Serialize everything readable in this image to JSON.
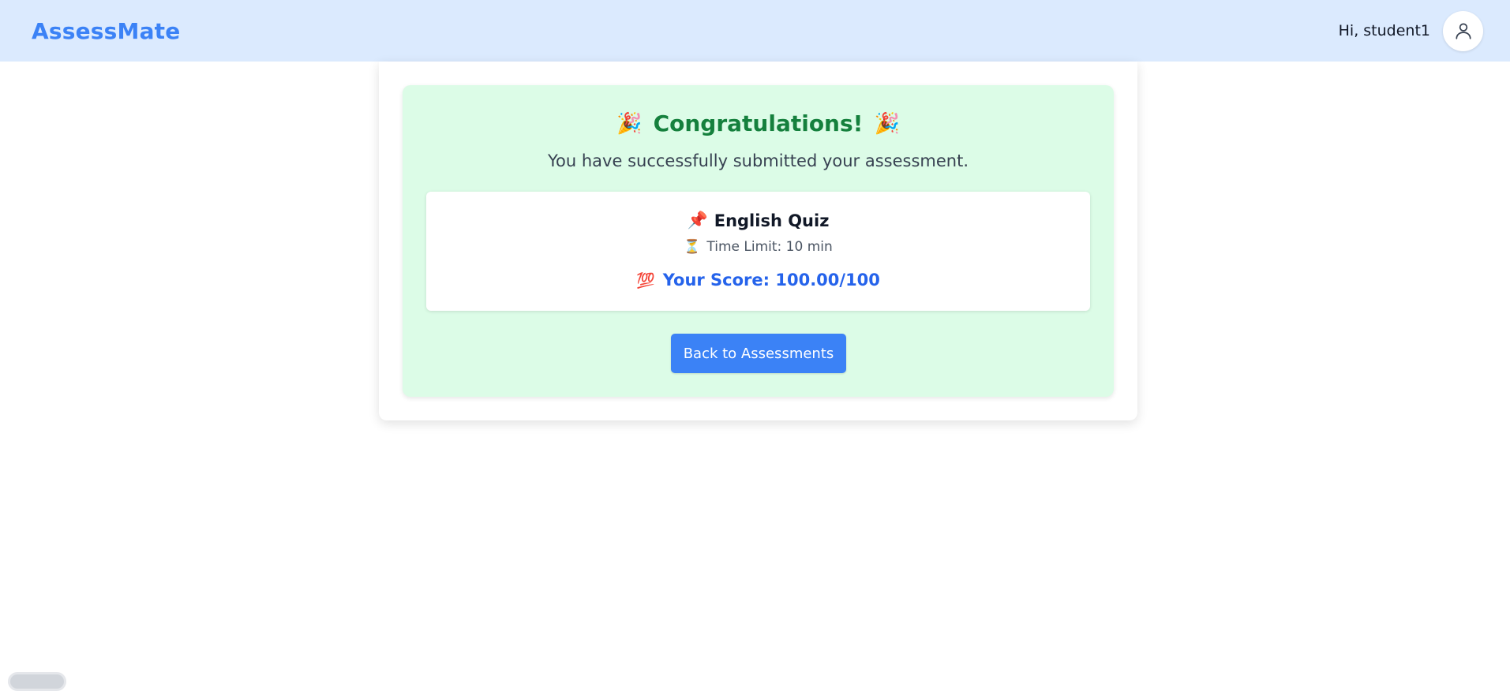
{
  "header": {
    "brand": "AssessMate",
    "greeting": "Hi, student1",
    "avatar_icon": "user-icon"
  },
  "result": {
    "title": "Congratulations!",
    "title_emoji_left": "🎉",
    "title_emoji_right": "🎉",
    "message": "You have successfully submitted your assessment.",
    "quiz": {
      "pin_emoji": "📌",
      "name": "English Quiz",
      "hourglass_emoji": "⏳",
      "time_limit": "Time Limit: 10 min",
      "score_emoji": "💯",
      "score": "Your Score: 100.00/100"
    },
    "back_button_label": "Back to Assessments"
  },
  "colors": {
    "header_bg": "#dbeafe",
    "brand": "#3b82f6",
    "success_bg": "#dcfce7",
    "success_title": "#15803d",
    "score": "#2563eb",
    "button": "#3b82f6"
  }
}
